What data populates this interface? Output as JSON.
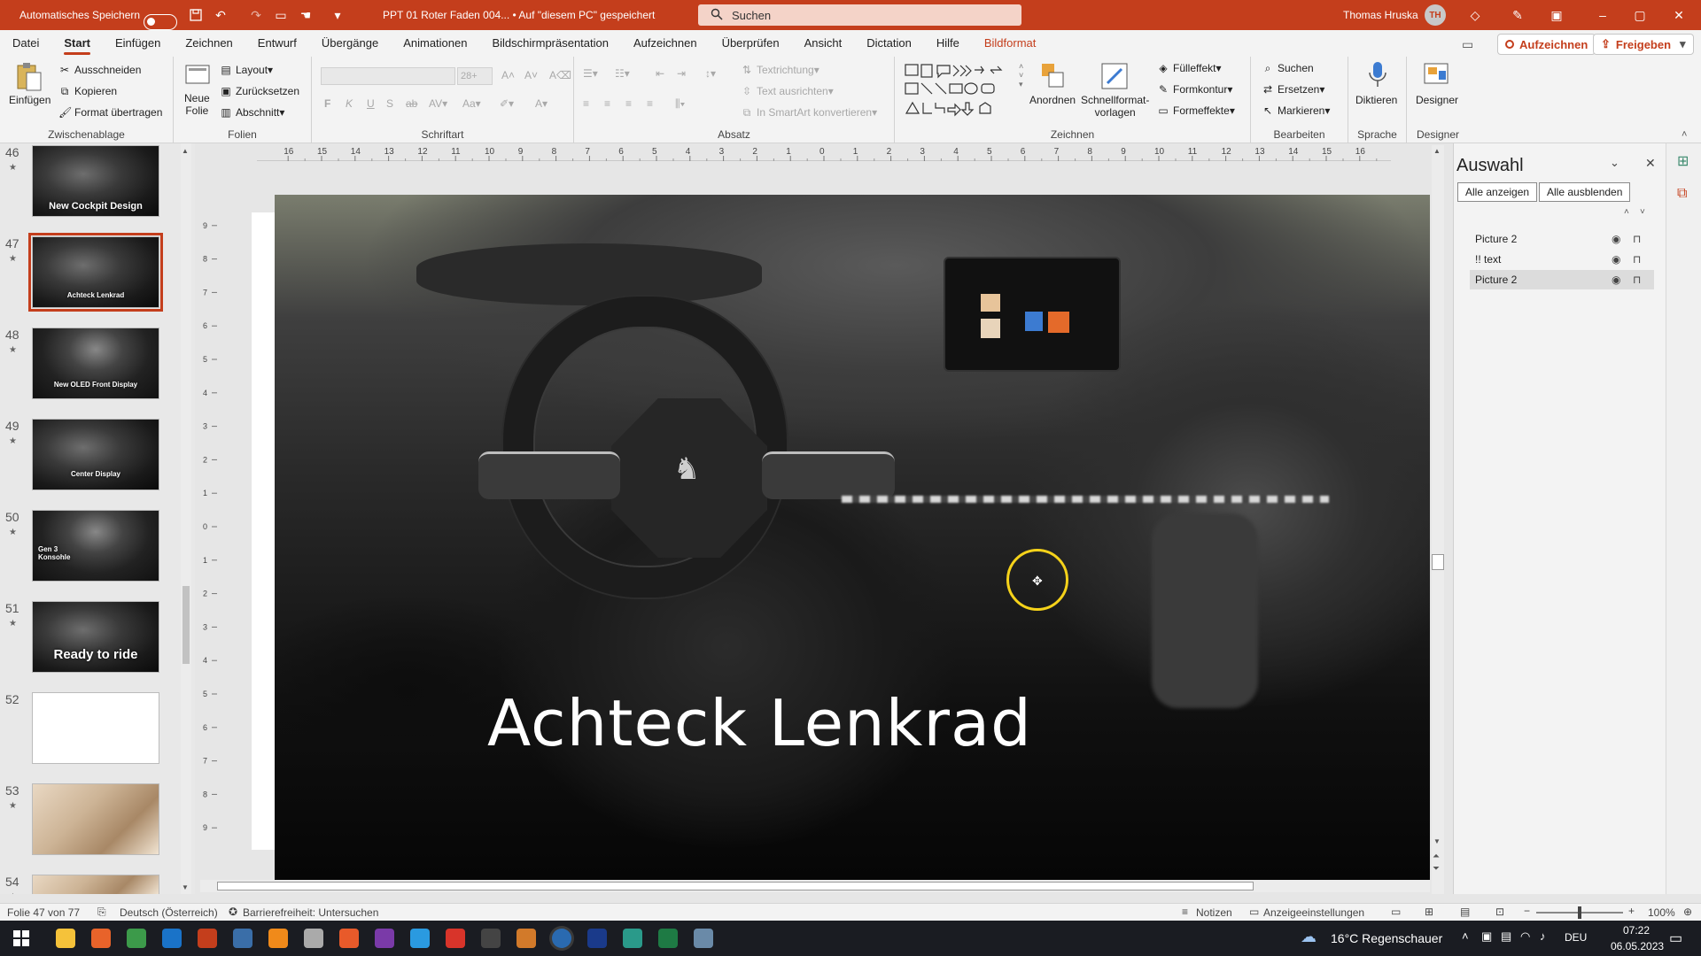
{
  "titlebar": {
    "autosave_label": "Automatisches Speichern",
    "document_title": "PPT 01 Roter Faden 004... • Auf \"diesem PC\" gespeichert",
    "search_placeholder": "Suchen",
    "user_name": "Thomas Hruska",
    "user_initials": "TH"
  },
  "menus": [
    "Datei",
    "Start",
    "Einfügen",
    "Zeichnen",
    "Entwurf",
    "Übergänge",
    "Animationen",
    "Bildschirmpräsentation",
    "Aufzeichnen",
    "Überprüfen",
    "Ansicht",
    "Dictation",
    "Hilfe",
    "Bildformat"
  ],
  "menu_active": "Start",
  "buttons": {
    "record": "Aufzeichnen",
    "share": "Freigeben"
  },
  "ribbon": {
    "clipboard": {
      "label": "Zwischenablage",
      "paste": "Einfügen",
      "cut": "Ausschneiden",
      "copy": "Kopieren",
      "format_painter": "Format übertragen"
    },
    "slides": {
      "label": "Folien",
      "new_slide": "Neue\nFolie",
      "layout": "Layout",
      "reset": "Zurücksetzen",
      "section": "Abschnitt"
    },
    "font": {
      "label": "Schriftart",
      "size": "28+"
    },
    "paragraph": {
      "label": "Absatz",
      "text_direction": "Textrichtung",
      "align_text": "Text ausrichten",
      "smartart": "In SmartArt konvertieren"
    },
    "drawing": {
      "label": "Zeichnen",
      "arrange": "Anordnen",
      "quick_styles": "Schnellformat-\nvorlagen",
      "fill": "Fülleffekt",
      "outline": "Formkontur",
      "effects": "Formeffekte"
    },
    "editing": {
      "label": "Bearbeiten",
      "find": "Suchen",
      "replace": "Ersetzen",
      "select": "Markieren"
    },
    "voice": {
      "label": "Sprache",
      "dictate": "Diktieren"
    },
    "designer": {
      "label": "Designer",
      "designer": "Designer"
    }
  },
  "slides": [
    {
      "num": "46",
      "star": "★",
      "caption": "New Cockpit Design"
    },
    {
      "num": "47",
      "star": "★",
      "caption": "Achteck Lenkrad"
    },
    {
      "num": "48",
      "star": "★",
      "caption": "New OLED Front Display"
    },
    {
      "num": "49",
      "star": "★",
      "caption": "Center Display"
    },
    {
      "num": "50",
      "star": "★",
      "caption": "Gen 3\nKonsohle"
    },
    {
      "num": "51",
      "star": "★",
      "caption": "Ready to ride"
    },
    {
      "num": "52",
      "star": "",
      "caption": ""
    },
    {
      "num": "53",
      "star": "★",
      "caption": ""
    },
    {
      "num": "54",
      "star": "★",
      "caption": ""
    }
  ],
  "slide": {
    "caption": "Achteck Lenkrad"
  },
  "selection_pane": {
    "title": "Auswahl",
    "show_all": "Alle anzeigen",
    "hide_all": "Alle ausblenden",
    "layers": [
      "Picture 2",
      "!! text",
      "Picture 2"
    ]
  },
  "status": {
    "slide_info": "Folie 47 von 77",
    "language": "Deutsch (Österreich)",
    "accessibility": "Barrierefreiheit: Untersuchen",
    "notes": "Notizen",
    "display_settings": "Anzeigeeinstellungen",
    "zoom": "100%"
  },
  "taskbar": {
    "weather": "16°C  Regenschauer",
    "lang": "DEU",
    "time": "07:22",
    "date": "06.05.2023"
  },
  "colors": {
    "accent": "#c43e1c",
    "taskbar": "#1a1c22"
  }
}
